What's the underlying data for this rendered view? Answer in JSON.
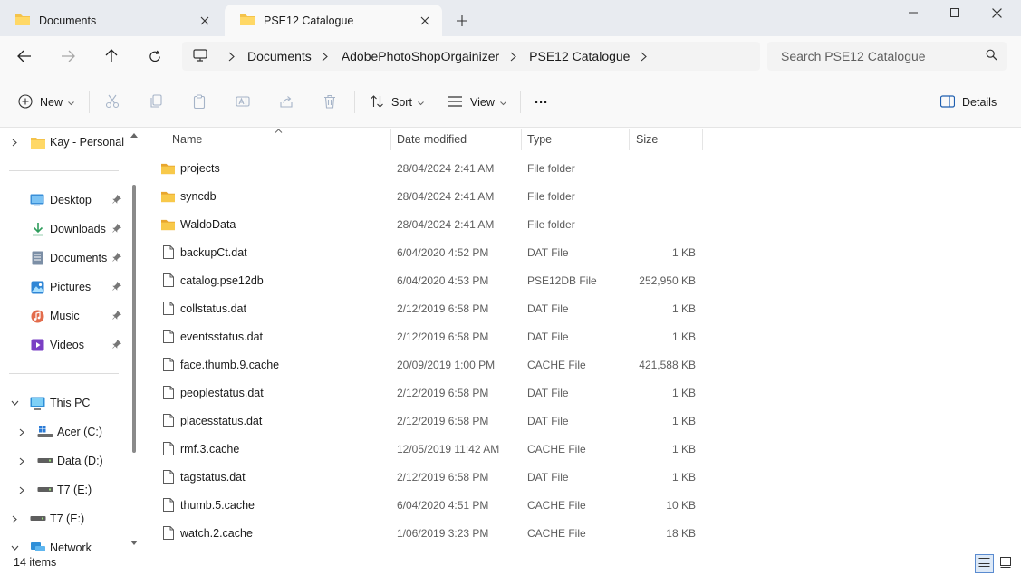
{
  "tabs": [
    {
      "label": "Documents",
      "active": false
    },
    {
      "label": "PSE12 Catalogue",
      "active": true
    }
  ],
  "address": {
    "crumbs": [
      "Documents",
      "AdobePhotoShopOrgainizer",
      "PSE12 Catalogue"
    ]
  },
  "search": {
    "placeholder": "Search PSE12 Catalogue"
  },
  "commands": {
    "new": "New",
    "sort": "Sort",
    "view": "View",
    "more": "···",
    "details": "Details"
  },
  "nav": {
    "home": "Kay - Personal",
    "desktop": "Desktop",
    "downloads": "Downloads",
    "documents": "Documents",
    "pictures": "Pictures",
    "music": "Music",
    "videos": "Videos",
    "thispc": "This PC",
    "drive_c": "Acer (C:)",
    "drive_d": "Data (D:)",
    "drive_e": "T7 (E:)",
    "drive_e2": "T7 (E:)",
    "network": "Network"
  },
  "columns": {
    "name": "Name",
    "date": "Date modified",
    "type": "Type",
    "size": "Size"
  },
  "files": [
    {
      "name": "projects",
      "date": "28/04/2024 2:41 AM",
      "type": "File folder",
      "size": "",
      "kind": "folder"
    },
    {
      "name": "syncdb",
      "date": "28/04/2024 2:41 AM",
      "type": "File folder",
      "size": "",
      "kind": "folder"
    },
    {
      "name": "WaldoData",
      "date": "28/04/2024 2:41 AM",
      "type": "File folder",
      "size": "",
      "kind": "folder"
    },
    {
      "name": "backupCt.dat",
      "date": "6/04/2020 4:52 PM",
      "type": "DAT File",
      "size": "1 KB",
      "kind": "file"
    },
    {
      "name": "catalog.pse12db",
      "date": "6/04/2020 4:53 PM",
      "type": "PSE12DB File",
      "size": "252,950 KB",
      "kind": "file"
    },
    {
      "name": "collstatus.dat",
      "date": "2/12/2019 6:58 PM",
      "type": "DAT File",
      "size": "1 KB",
      "kind": "file"
    },
    {
      "name": "eventsstatus.dat",
      "date": "2/12/2019 6:58 PM",
      "type": "DAT File",
      "size": "1 KB",
      "kind": "file"
    },
    {
      "name": "face.thumb.9.cache",
      "date": "20/09/2019 1:00 PM",
      "type": "CACHE File",
      "size": "421,588 KB",
      "kind": "file"
    },
    {
      "name": "peoplestatus.dat",
      "date": "2/12/2019 6:58 PM",
      "type": "DAT File",
      "size": "1 KB",
      "kind": "file"
    },
    {
      "name": "placesstatus.dat",
      "date": "2/12/2019 6:58 PM",
      "type": "DAT File",
      "size": "1 KB",
      "kind": "file"
    },
    {
      "name": "rmf.3.cache",
      "date": "12/05/2019 11:42 AM",
      "type": "CACHE File",
      "size": "1 KB",
      "kind": "file"
    },
    {
      "name": "tagstatus.dat",
      "date": "2/12/2019 6:58 PM",
      "type": "DAT File",
      "size": "1 KB",
      "kind": "file"
    },
    {
      "name": "thumb.5.cache",
      "date": "6/04/2020 4:51 PM",
      "type": "CACHE File",
      "size": "10 KB",
      "kind": "file"
    },
    {
      "name": "watch.2.cache",
      "date": "1/06/2019 3:23 PM",
      "type": "CACHE File",
      "size": "18 KB",
      "kind": "file"
    }
  ],
  "status": {
    "item_count": "14 items"
  },
  "colors": {
    "tab_bar": "#e8ebf0",
    "toolbar": "#f9f9f9",
    "folder": "#f4c34b",
    "accent": "#0067c0"
  }
}
